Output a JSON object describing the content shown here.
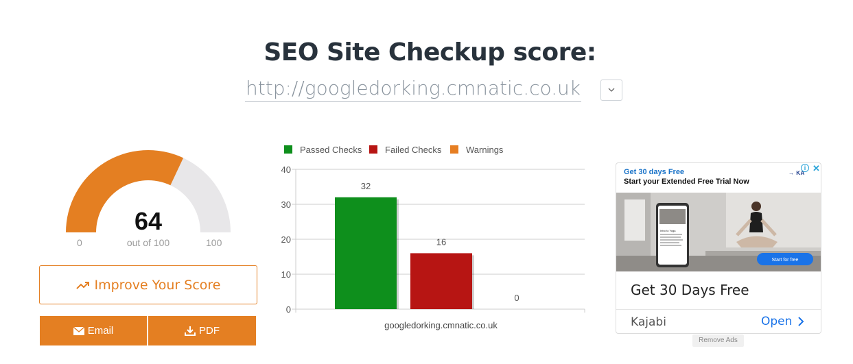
{
  "header": {
    "title": "SEO Site Checkup score:",
    "url": "http://googledorking.cmnatic.co.uk"
  },
  "gauge": {
    "score": "64",
    "score_value": 64,
    "min_label": "0",
    "out_of_label": "out of 100",
    "max_label": "100",
    "fill_color": "#e47f22",
    "track_color": "#e8e7e9"
  },
  "actions": {
    "improve_label": "Improve Your Score",
    "email_label": "Email",
    "pdf_label": "PDF",
    "accent_color": "#e47f22"
  },
  "chart_data": {
    "type": "bar",
    "categories": [
      "googledorking.cmnatic.co.uk"
    ],
    "series": [
      {
        "name": "Passed Checks",
        "values": [
          32
        ],
        "color": "#0e8f1c"
      },
      {
        "name": "Failed Checks",
        "values": [
          16
        ],
        "color": "#b71513"
      },
      {
        "name": "Warnings",
        "values": [
          0
        ],
        "color": "#e67e22"
      }
    ],
    "ylim": [
      0,
      40
    ],
    "yticks": [
      "0",
      "10",
      "20",
      "30",
      "40"
    ],
    "data_labels": [
      "32",
      "16",
      "0"
    ],
    "legend_position": "top",
    "grid": true
  },
  "ad": {
    "headline_top": "Get 30 days Free",
    "subheadline_top": "Start your Extended Free Trial Now",
    "logo_text": "KAJABI",
    "cta_image_label": "Start for free",
    "phone_heading": "Intro to Yoga",
    "title": "Get 30 Days Free",
    "advertiser": "Kajabi",
    "open_label": "Open",
    "info_icon": "i",
    "close_icon": "✕",
    "remove_ads_label": "Remove Ads"
  }
}
